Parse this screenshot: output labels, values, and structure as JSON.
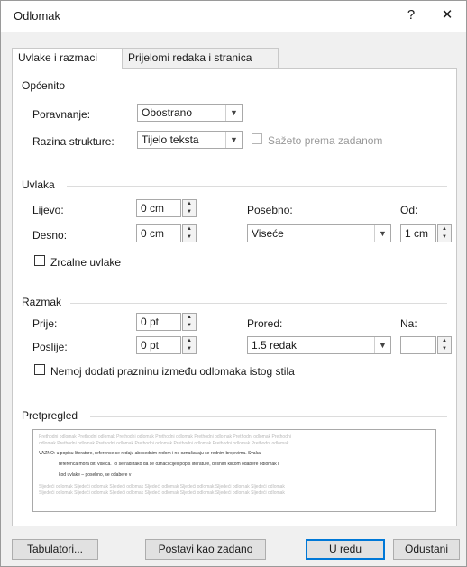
{
  "window": {
    "title": "Odlomak",
    "help_label": "?",
    "close_label": "✕"
  },
  "tabs": [
    {
      "label": "Uvlake i razmaci"
    },
    {
      "label": "Prijelomi redaka i stranica"
    }
  ],
  "general": {
    "section_label": "Općenito",
    "alignment_label": "Poravnanje:",
    "alignment_value": "Obostrano",
    "outline_label": "Razina strukture:",
    "outline_value": "Tijelo teksta",
    "collapsed_label": "Sažeto prema zadanom"
  },
  "indent": {
    "section_label": "Uvlaka",
    "left_label": "Lijevo:",
    "left_value": "0 cm",
    "right_label": "Desno:",
    "right_value": "0 cm",
    "special_label": "Posebno:",
    "special_value": "Viseće",
    "by_label": "Od:",
    "by_value": "1 cm",
    "mirror_label": "Zrcalne uvlake"
  },
  "spacing": {
    "section_label": "Razmak",
    "before_label": "Prije:",
    "before_value": "0 pt",
    "after_label": "Poslije:",
    "after_value": "0 pt",
    "line_spacing_label": "Prored:",
    "line_spacing_value": "1.5 redak",
    "at_label": "Na:",
    "at_value": "",
    "dont_add_label": "Nemoj dodati prazninu između odlomaka istog stila"
  },
  "preview": {
    "section_label": "Pretpregled",
    "prev_lines": [
      "Prethodni odlomak Prethodni odlomak Prethodni odlomak Prethodni odlomak Prethodni odlomak Prethodni odlomak Prethodni",
      "odlomak Prethodni odlomak Prethodni odlomak Prethodni odlomak Prethodni odlomak Prethodni odlomak Prethodni odlomak"
    ],
    "text_lines": [
      "VAŽNO: u popisu literature, reference se redaju abecednim redom i ne označavaju se rednim brojevima. Svaka",
      "referenca mora biti viseća. To se radi tako da se označi cijeli popis literature, desnim klikom odabere odlomak i",
      "kod uvlake – posebno, se odabere v"
    ],
    "next_lines": [
      "Sljedeći odlomak Sljedeći odlomak Sljedeći odlomak Sljedeći odlomak Sljedeći odlomak Sljedeći odlomak Sljedeći odlomak",
      "Sljedeći odlomak Sljedeći odlomak Sljedeći odlomak Sljedeći odlomak Sljedeći odlomak Sljedeći odlomak Sljedeći odlomak"
    ]
  },
  "buttons": {
    "tabs_label": "Tabulatori...",
    "default_label": "Postavi kao zadano",
    "ok_label": "U redu",
    "cancel_label": "Odustani"
  },
  "icons": {
    "dropdown": "chevron-down-icon",
    "spin": "spin-arrows-icon"
  }
}
